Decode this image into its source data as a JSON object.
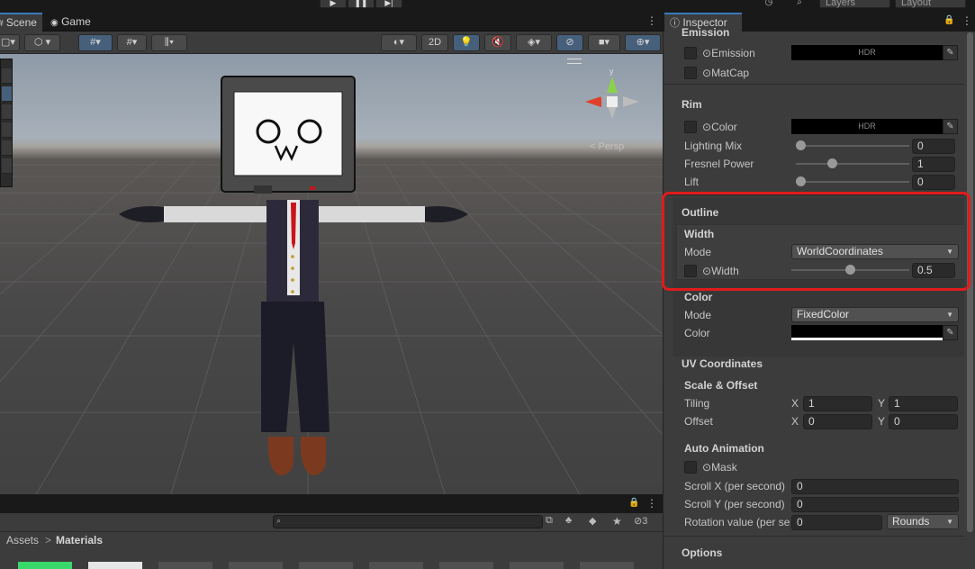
{
  "toolbar": {
    "play_icon": "play-icon",
    "pause_icon": "pause-icon",
    "step_icon": "step-icon",
    "history_icon": "history-icon",
    "search_icon": "search-icon",
    "layers_label": "Layers",
    "layout_label": "Layout"
  },
  "scene_tabs": [
    {
      "label": "Scene",
      "icon": "hash-icon"
    },
    {
      "label": "Game",
      "icon": "gamepad-icon"
    }
  ],
  "scene_toolbar": {
    "two_d_label": "2D"
  },
  "gizmo": {
    "y_label": "y",
    "persp_label": "< Persp"
  },
  "project": {
    "search_placeholder": "",
    "hidden_count": "3",
    "breadcrumb_root": "Assets",
    "breadcrumb_sep": ">",
    "breadcrumb_current": "Materials"
  },
  "inspector": {
    "tab_label": "Inspector",
    "emission_header": "Emission",
    "emission_label": "Emission",
    "hdr_label": "HDR",
    "matcap_label": "MatCap",
    "rim_header": "Rim",
    "rim_color_label": "Color",
    "lighting_mix_label": "Lighting Mix",
    "lighting_mix_value": "0",
    "lighting_mix_level": 0,
    "fresnel_power_label": "Fresnel Power",
    "fresnel_power_value": "1",
    "fresnel_power_level": 0.3,
    "lift_label": "Lift",
    "lift_value": "0",
    "lift_level": 0,
    "outline_header": "Outline",
    "width_sub": "Width",
    "mode_label": "Mode",
    "width_mode_value": "WorldCoordinates",
    "width_label": "Width",
    "width_value": "0.5",
    "width_level": 0.5,
    "color_sub": "Color",
    "color_mode_label": "Mode",
    "color_mode_value": "FixedColor",
    "color_label": "Color",
    "outline_color": "#000000",
    "uv_header": "UV Coordinates",
    "scale_offset_sub": "Scale & Offset",
    "tiling_label": "Tiling",
    "tiling_x": "1",
    "tiling_y": "1",
    "offset_label": "Offset",
    "offset_x": "0",
    "offset_y": "0",
    "x_label": "X",
    "y_label": "Y",
    "auto_anim_sub": "Auto Animation",
    "mask_label": "Mask",
    "scroll_x_label": "Scroll X (per second)",
    "scroll_x_value": "0",
    "scroll_y_label": "Scroll Y (per second)",
    "scroll_y_value": "0",
    "rotation_label": "Rotation value (per se",
    "rotation_value": "0",
    "rotation_unit": "Rounds",
    "options_header": "Options"
  },
  "colors": {
    "highlight": "#e01b1b",
    "accent": "#3a79bb"
  }
}
